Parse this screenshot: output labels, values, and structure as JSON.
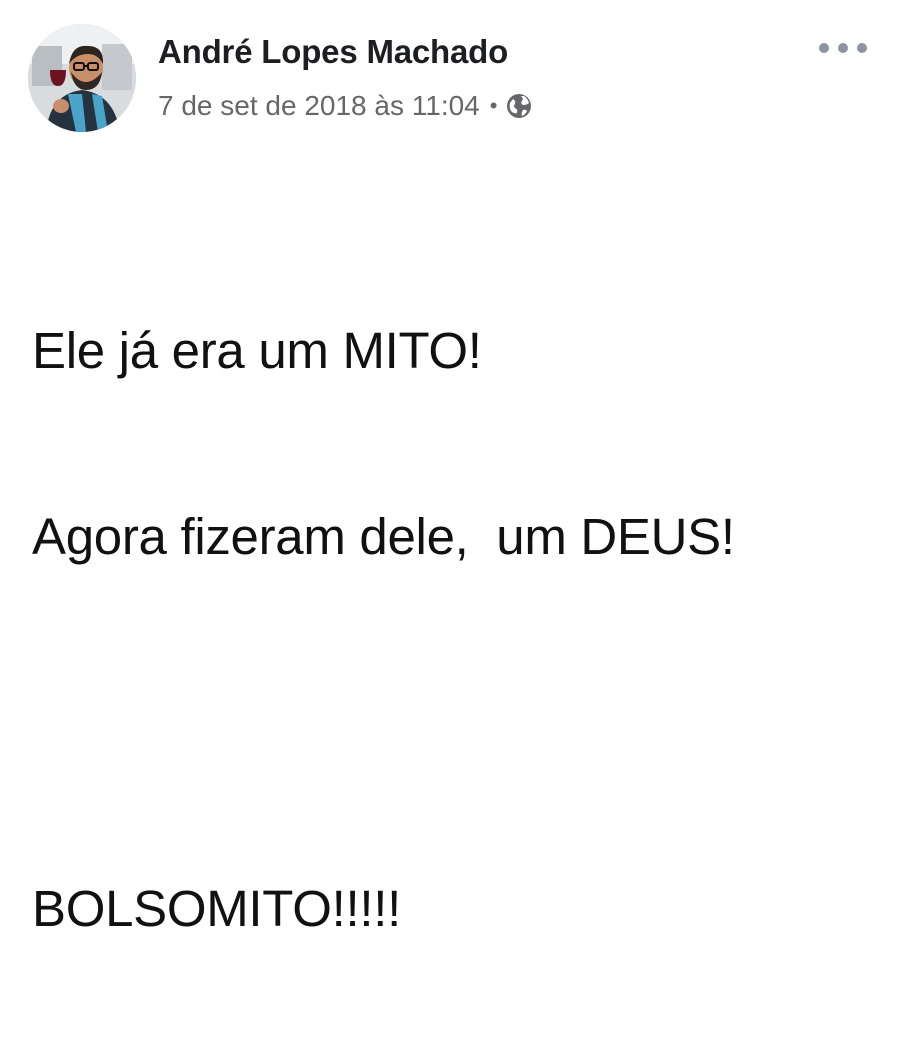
{
  "post": {
    "author_name": "André Lopes Machado",
    "timestamp": "7 de set de 2018 às 11:04",
    "separator": "•",
    "privacy_icon": "globe-icon",
    "avatar_icon": "profile-photo",
    "more_icon": "more-options-icon",
    "lines": [
      "Ele já era um MITO!",
      "Agora fizeram dele,  um DEUS!",
      "",
      "BOLSOMITO!!!!!"
    ]
  },
  "colors": {
    "name": "#1c1e21",
    "meta": "#65676b",
    "more_dots": "#8d949e",
    "body_text": "#111111",
    "background": "#ffffff"
  }
}
